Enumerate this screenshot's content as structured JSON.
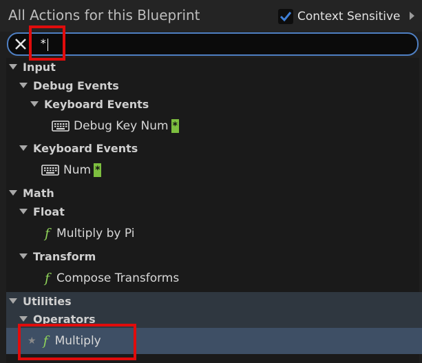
{
  "header": {
    "title": "All Actions for this Blueprint",
    "context_label": "Context Sensitive",
    "context_checked": true
  },
  "search": {
    "value": "*"
  },
  "tree": {
    "input": "Input",
    "debug_events": "Debug Events",
    "keyboard_events_1": "Keyboard Events",
    "debug_key_num": "Debug Key Num",
    "debug_key_num_match": "*",
    "keyboard_events_2": "Keyboard Events",
    "num": "Num",
    "num_match": "*",
    "math": "Math",
    "float": "Float",
    "multiply_by_pi": "Multiply by Pi",
    "transform": "Transform",
    "compose_transforms": "Compose Transforms",
    "utilities": "Utilities",
    "operators": "Operators",
    "multiply": "Multiply"
  },
  "icons": {
    "function": "f",
    "favorite": "★"
  },
  "colors": {
    "accent": "#4f80c4",
    "function_icon": "#8fd35a",
    "match_highlight": "#7dbf3f",
    "annotation": "#e00c0c"
  }
}
